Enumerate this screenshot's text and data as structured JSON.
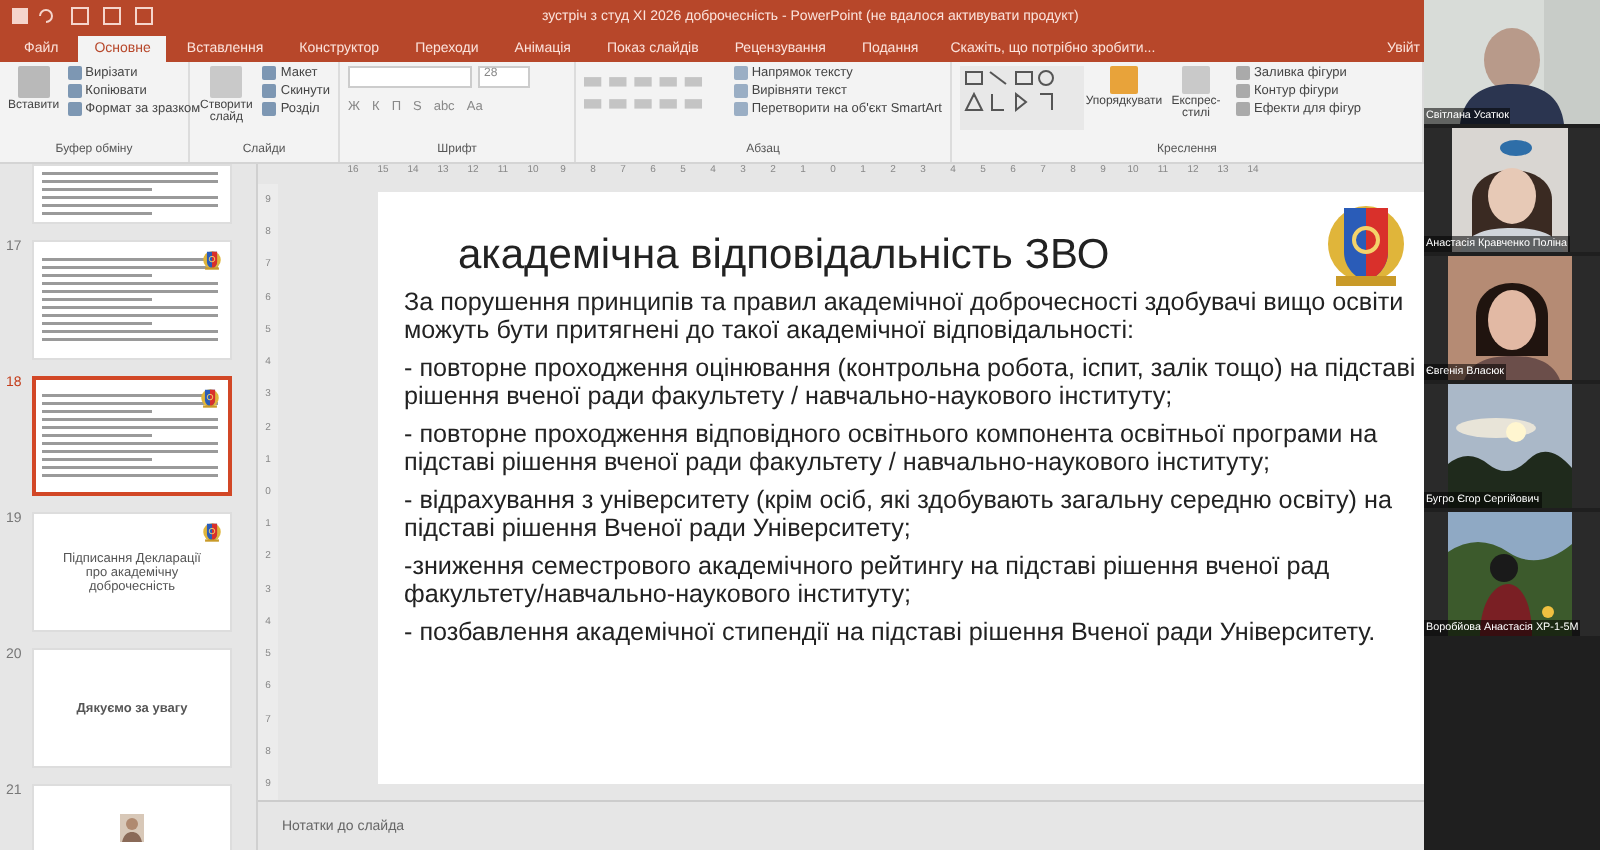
{
  "window": {
    "title": "зустріч з студ ХІ 2026 доброчесність - PowerPoint (не вдалося активувати продукт)"
  },
  "tabs": [
    {
      "label": "Файл",
      "selected": false
    },
    {
      "label": "Основне",
      "selected": true
    },
    {
      "label": "Вставлення",
      "selected": false
    },
    {
      "label": "Конструктор",
      "selected": false
    },
    {
      "label": "Переходи",
      "selected": false
    },
    {
      "label": "Анімація",
      "selected": false
    },
    {
      "label": "Показ слайдів",
      "selected": false
    },
    {
      "label": "Рецензування",
      "selected": false
    },
    {
      "label": "Подання",
      "selected": false
    }
  ],
  "tell_me": "Скажіть, що потрібно зробити...",
  "sign_in": "Увійт",
  "ribbon": {
    "groups": [
      {
        "label": "Буфер обміну",
        "kind": "clipboard",
        "large": "Вставити",
        "small": [
          "Вирізати",
          "Копіювати",
          "Формат за зразком"
        ]
      },
      {
        "label": "Слайди",
        "kind": "slides",
        "large": "Створити слайд",
        "small": [
          "Макет",
          "Скинути",
          "Розділ"
        ]
      },
      {
        "label": "Шрифт",
        "kind": "font",
        "font_size": "28",
        "format": [
          "Ж",
          "К",
          "П",
          "S",
          "abc",
          "Аа"
        ]
      },
      {
        "label": "Абзац",
        "kind": "paragraph",
        "small": [
          "Напрямок тексту",
          "Вирівняти текст",
          "Перетворити на об'єкт SmartArt"
        ]
      },
      {
        "label": "Креслення",
        "kind": "drawing",
        "large": [
          "Упорядкувати",
          "Експрес-стилі"
        ],
        "small": [
          "Заливка фігури",
          "Контур фігури",
          "Ефекти для фігур"
        ]
      }
    ]
  },
  "ruler": {
    "horizontal": [
      "16",
      "15",
      "14",
      "13",
      "12",
      "11",
      "10",
      "9",
      "8",
      "7",
      "6",
      "5",
      "4",
      "3",
      "2",
      "1",
      "0",
      "1",
      "2",
      "3",
      "4",
      "5",
      "6",
      "7",
      "8",
      "9",
      "10",
      "11",
      "12",
      "13",
      "14"
    ],
    "vertical": [
      "9",
      "8",
      "7",
      "6",
      "5",
      "4",
      "3",
      "2",
      "1",
      "0",
      "1",
      "2",
      "3",
      "4",
      "5",
      "6",
      "7",
      "8",
      "9"
    ]
  },
  "thumbnails": [
    {
      "kind": "bullets",
      "selected": false
    },
    {
      "number": "17",
      "kind": "bullets",
      "selected": false
    },
    {
      "number": "18",
      "kind": "bullets",
      "selected": true
    },
    {
      "number": "19",
      "kind": "title",
      "text": "Підписання Декларації про академічну доброчесність",
      "selected": false
    },
    {
      "number": "20",
      "kind": "closing",
      "text": "Дякуємо за увагу",
      "selected": false
    },
    {
      "number": "21",
      "kind": "portrait",
      "selected": false
    }
  ],
  "slide": {
    "title": "академічна відповідальність ЗВО",
    "paragraphs": [
      "За порушення принципів та правил академічної доброчесності здобувачі вищо освіти можуть бути притягнені до такої академічної відповідальності:",
      "- повторне проходження оцінювання (контрольна робота, іспит, залік тощо) на підставі рішення вченої ради факультету / навчально-наукового інституту;",
      "- повторне проходження відповідного освітнього компонента освітньої програми на підставі рішення вченої ради факультету / навчально-наукового інституту;",
      "- відрахування з університету (крім осіб, які здобувають загальну середню освіту) на підставі рішення Вченої ради Університету;",
      "-зниження семестрового академічного рейтингу на підставі рішення вченої рад факультету/навчально-наукового інституту;",
      "- позбавлення академічної стипендії на підставі рішення Вченої ради Університету."
    ]
  },
  "notes_placeholder": "Нотатки до слайда",
  "participants": [
    {
      "name": "Світлана Усатюк"
    },
    {
      "name": "Анастасія Кравченко Поліна"
    },
    {
      "name": "Євгенія Власюк"
    },
    {
      "name": "Бугро Єгор Сергійович"
    },
    {
      "name": "Воробйова Анастасія ХР-1-5М"
    }
  ]
}
